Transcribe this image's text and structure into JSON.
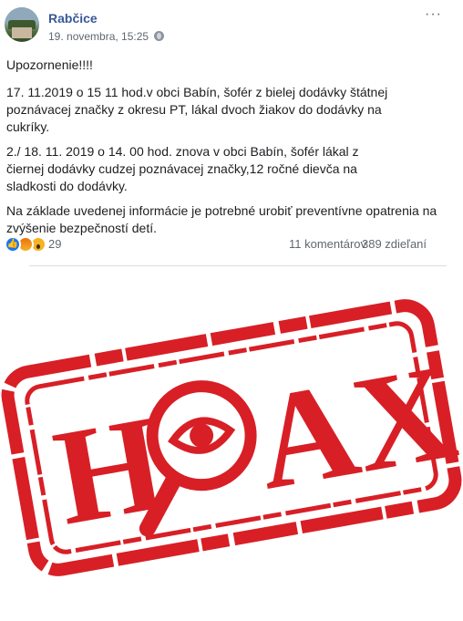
{
  "post": {
    "page_name": "Rabčice",
    "date": "19. novembra, 15:25",
    "icons": {
      "privacy": "globe-icon",
      "menu": "more-icon"
    }
  },
  "content": {
    "paragraphs": [
      "Upozornenie!!!!",
      "17. 11.2019 o 15 11 hod.v obci Babín, šofér z bielej dodávky štátnej poznávacej značky z okresu PT, lákal dvoch žiakov do dodávky na cukríky.",
      "2./ 18. 11. 2019 o 14. 00 hod. znova v obci Babín, šofér lákal z čiernej dodávky cudzej poznávacej značky,12 ročné dievča na sladkosti do dodávky.",
      "Na základe uvedenej informácie je potrebné urobiť preventívne opatrenia na zvýšenie bezpečností detí."
    ]
  },
  "footer": {
    "reaction_count": "29",
    "comments": "11 komentárov",
    "shares": "389 zdieľaní",
    "reaction_icons": [
      "like-icon",
      "angry-icon",
      "wow-icon"
    ]
  },
  "stamp": {
    "text_left": "H",
    "text_right": "AX",
    "color": "#d81f26"
  }
}
